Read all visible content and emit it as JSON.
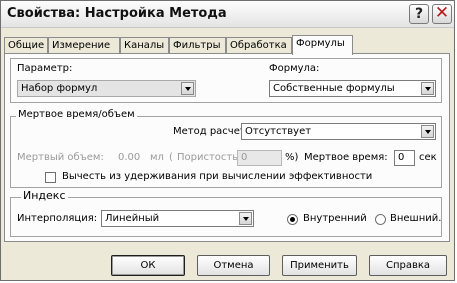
{
  "window": {
    "title": "Свойства: Настройка Метода",
    "help_glyph": "?",
    "close_glyph": "✕"
  },
  "tabs": [
    {
      "label": "Общие"
    },
    {
      "label": "Измерение"
    },
    {
      "label": "Каналы"
    },
    {
      "label": "Фильтры"
    },
    {
      "label": "Обработка"
    },
    {
      "label": "Формулы"
    }
  ],
  "active_tab": "Формулы",
  "parameter": {
    "label": "Параметр:",
    "value": "Набор формул"
  },
  "formula": {
    "label": "Формула:",
    "value": "Собственные формулы"
  },
  "dead_volume": {
    "group_title": "Мертвое время/объем",
    "method_label": "Метод расчета:",
    "method_value": "Отсутствует",
    "volume_label": "Мертвый объем:",
    "volume_value": "0.00",
    "volume_unit": "мл",
    "porosity_open": "(",
    "porosity_label": "Пористость",
    "porosity_value": "0",
    "porosity_close": "%)",
    "time_label": "Мертвое время:",
    "time_value": "0",
    "time_unit": "сек",
    "subtract_label": "Вычесть из удерживания при вычислении эффективности"
  },
  "index": {
    "group_title": "Индекс",
    "interp_label": "Интерполяция:",
    "interp_value": "Линейный",
    "internal_label": "Внутренний",
    "external_label": "Внешний."
  },
  "buttons": {
    "ok": "ОК",
    "cancel": "Отмена",
    "apply": "Применить",
    "help": "Справка"
  },
  "colors": {
    "dialog_bg": "#ece9d8",
    "panel_bg": "#fcfcfc",
    "close_accent": "#b81818"
  }
}
